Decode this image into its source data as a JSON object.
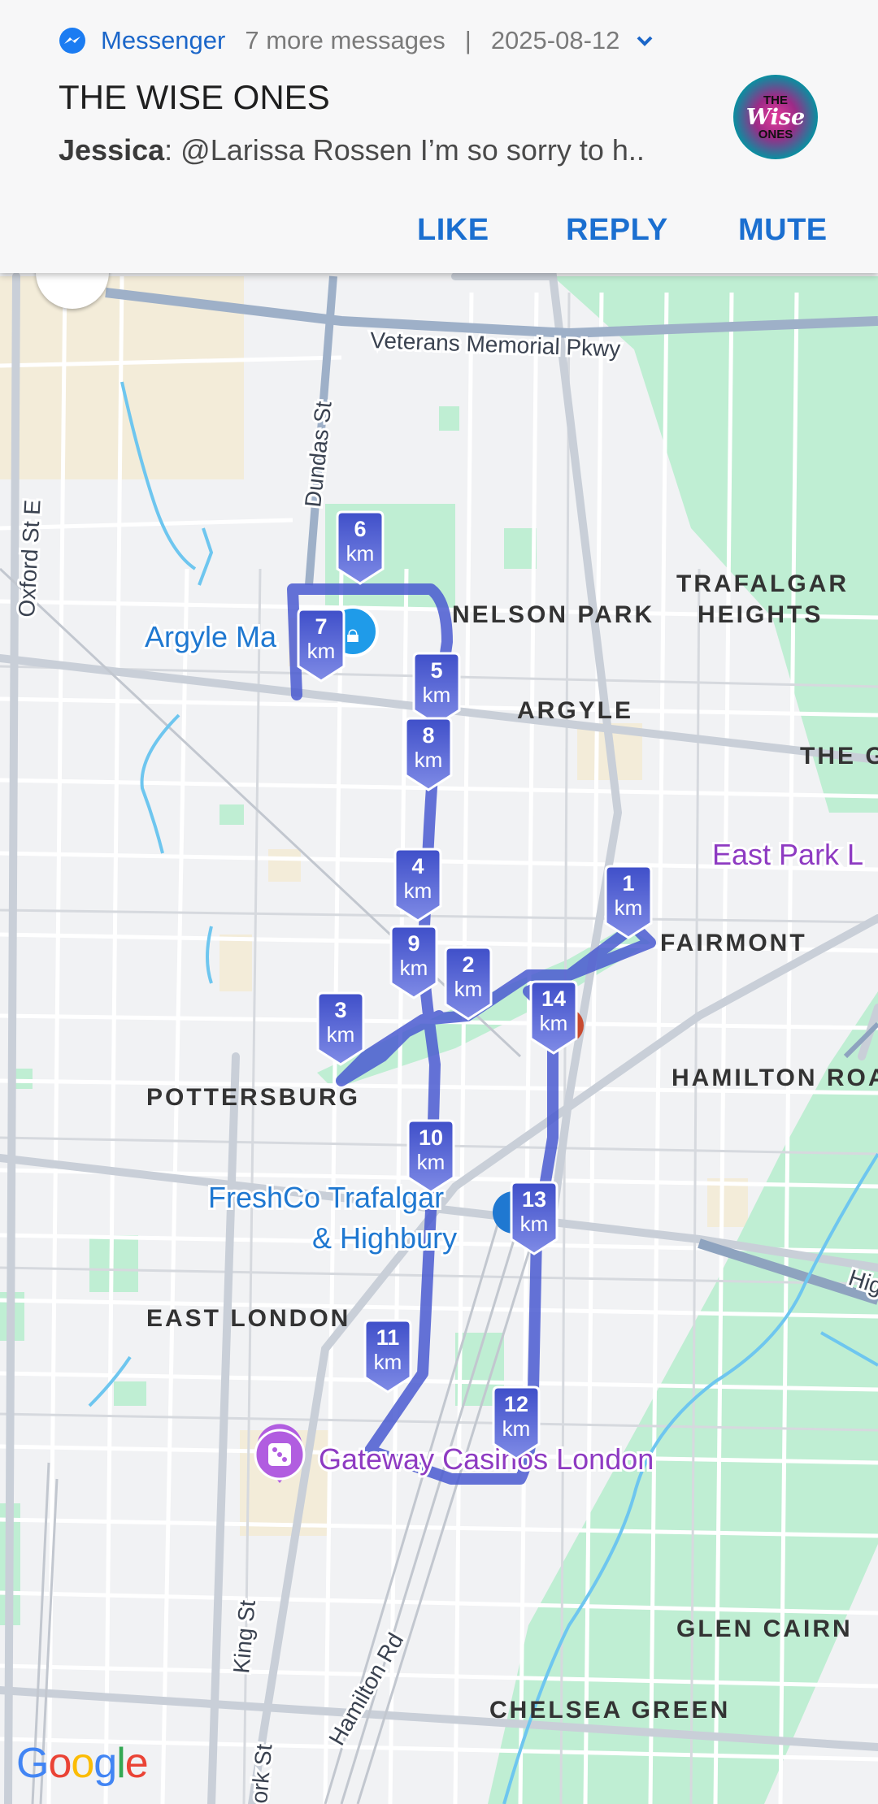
{
  "notification": {
    "app_name": "Messenger",
    "more_messages": "7 more messages",
    "separator": "|",
    "date": "2025-08-12",
    "title": "THE WISE ONES",
    "sender": "Jessica",
    "message": ": @Larissa Rossen I’m so sorry to h..",
    "avatar_text": [
      "THE",
      "Wise",
      "ONES"
    ],
    "actions": {
      "like": "LIKE",
      "reply": "REPLY",
      "mute": "MUTE"
    }
  },
  "map": {
    "provider_logo": "Google",
    "area_labels": {
      "nelson_park": "NELSON PARK",
      "trafalgar_heights_1": "TRAFALGAR",
      "trafalgar_heights_2": "HEIGHTS",
      "argyle": "ARGYLE",
      "the_g": "THE G",
      "fairmont": "FAIRMONT",
      "hamilton_roa": "HAMILTON ROA",
      "pottersburg": "POTTERSBURG",
      "east_london": "EAST LONDON",
      "glen_cairn": "GLEN CAIRN",
      "chelsea_green": "CHELSEA GREEN"
    },
    "street_labels": {
      "veterans": "Veterans Memorial Pkwy",
      "dundas": "Dundas St",
      "oxford": "Oxford St E",
      "king": "King St",
      "york": "ork St",
      "hamilton_rd": "Hamilton Rd",
      "hig": "Hig"
    },
    "places": {
      "argyle_mall": "Argyle Ma",
      "freshco_1": "FreshCo Trafalgar",
      "freshco_2": "& Highbury",
      "gateway": "Gateway Casinos London",
      "east_park": "East Park L"
    },
    "km_unit": "km",
    "km_markers": [
      "1",
      "2",
      "3",
      "4",
      "5",
      "6",
      "7",
      "8",
      "9",
      "10",
      "11",
      "12",
      "13",
      "14"
    ],
    "colors": {
      "route": "#4a5ad0",
      "marker": "#4655cf",
      "park": "#bfeed3",
      "water": "#6ec6ef",
      "place_blue": "#1f78d1",
      "place_purple": "#8e3bc2"
    }
  }
}
